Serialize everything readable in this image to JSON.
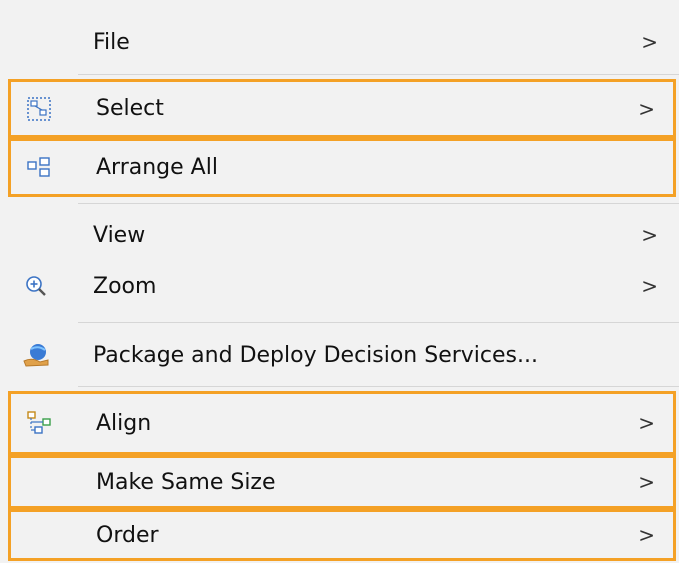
{
  "menu": {
    "highlight_color": "#f4a126",
    "items": [
      {
        "label": "File",
        "icon": "none",
        "has_submenu": true,
        "arrow": ">"
      },
      {
        "label": "Select",
        "icon": "select-icon",
        "has_submenu": true,
        "arrow": ">"
      },
      {
        "label": "Arrange All",
        "icon": "arrange-all-icon",
        "has_submenu": false
      },
      {
        "label": "View",
        "icon": "none",
        "has_submenu": true,
        "arrow": ">"
      },
      {
        "label": "Zoom",
        "icon": "zoom-icon",
        "has_submenu": true,
        "arrow": ">"
      },
      {
        "label": "Package and Deploy Decision Services...",
        "icon": "package-deploy-icon",
        "has_submenu": false
      },
      {
        "label": "Align",
        "icon": "align-icon",
        "has_submenu": true,
        "arrow": ">"
      },
      {
        "label": "Make Same Size",
        "icon": "none",
        "has_submenu": true,
        "arrow": ">"
      },
      {
        "label": "Order",
        "icon": "none",
        "has_submenu": true,
        "arrow": ">"
      }
    ]
  }
}
